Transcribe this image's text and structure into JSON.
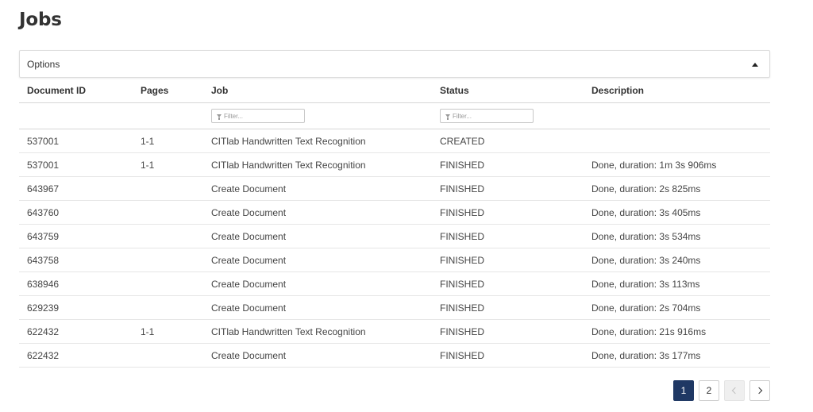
{
  "page": {
    "title": "Jobs"
  },
  "options": {
    "label": "Options"
  },
  "table": {
    "headers": {
      "document_id": "Document ID",
      "pages": "Pages",
      "job": "Job",
      "status": "Status",
      "description": "Description"
    },
    "filters": {
      "job_placeholder": "Filter...",
      "status_placeholder": "Filter..."
    },
    "rows": [
      {
        "document_id": "537001",
        "pages": "1-1",
        "job": "CITlab Handwritten Text Recognition",
        "status": "CREATED",
        "description": ""
      },
      {
        "document_id": "537001",
        "pages": "1-1",
        "job": "CITlab Handwritten Text Recognition",
        "status": "FINISHED",
        "description": "Done, duration: 1m 3s 906ms"
      },
      {
        "document_id": "643967",
        "pages": "",
        "job": "Create Document",
        "status": "FINISHED",
        "description": "Done, duration: 2s 825ms"
      },
      {
        "document_id": "643760",
        "pages": "",
        "job": "Create Document",
        "status": "FINISHED",
        "description": "Done, duration: 3s 405ms"
      },
      {
        "document_id": "643759",
        "pages": "",
        "job": "Create Document",
        "status": "FINISHED",
        "description": "Done, duration: 3s 534ms"
      },
      {
        "document_id": "643758",
        "pages": "",
        "job": "Create Document",
        "status": "FINISHED",
        "description": "Done, duration: 3s 240ms"
      },
      {
        "document_id": "638946",
        "pages": "",
        "job": "Create Document",
        "status": "FINISHED",
        "description": "Done, duration: 3s 113ms"
      },
      {
        "document_id": "629239",
        "pages": "",
        "job": "Create Document",
        "status": "FINISHED",
        "description": "Done, duration: 2s 704ms"
      },
      {
        "document_id": "622432",
        "pages": "1-1",
        "job": "CITlab Handwritten Text Recognition",
        "status": "FINISHED",
        "description": "Done, duration: 21s 916ms"
      },
      {
        "document_id": "622432",
        "pages": "",
        "job": "Create Document",
        "status": "FINISHED",
        "description": "Done, duration: 3s 177ms"
      }
    ]
  },
  "pagination": {
    "pages": [
      "1",
      "2"
    ],
    "current": "1",
    "prev_icon": "chevron-left-icon",
    "next_icon": "chevron-right-icon"
  },
  "colors": {
    "active_page": "#1f3864"
  }
}
